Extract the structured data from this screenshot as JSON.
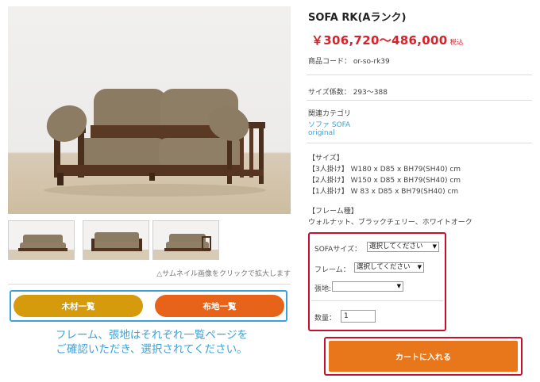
{
  "product": {
    "title": "SOFA RK(Aランク)",
    "price": "￥306,720～486,000",
    "tax_label": "税込",
    "code_label": "商品コード：",
    "code_value": "or-so-rk39",
    "size_label": "サイズ係数：",
    "size_value": "293～388"
  },
  "category": {
    "heading": "関連カテゴリ",
    "links": [
      "ソファ SOFA",
      "original"
    ]
  },
  "specs": {
    "size_heading": "【サイズ】",
    "size_lines": [
      "【3人掛け】 W180 x D85 x BH79(SH40) cm",
      "【2人掛け】 W150 x D85 x BH79(SH40) cm",
      "【1人掛け】 W 83 x D85 x BH79(SH40) cm"
    ],
    "frame_heading": "【フレーム種】",
    "frame_values": "ウォルナット、ブラックチェリー、ホワイトオーク"
  },
  "options": {
    "sofa_size_label": "SOFAサイズ：",
    "sofa_size_value": "選択してください",
    "frame_label": "フレーム：",
    "frame_value": "選択してください",
    "fabric_label": "張地:",
    "fabric_value": "",
    "qty_label": "数量：",
    "qty_value": "1"
  },
  "gallery": {
    "thumb_note": "△サムネイル画像をクリックで拡大します"
  },
  "buttons": {
    "wood_list": "木材一覧",
    "fabric_list": "布地一覧",
    "add_to_cart": "カートに入れる"
  },
  "annotation": {
    "line1": "フレーム、張地はそれぞれ一覧ページを",
    "line2": "ご確認いただき、選択されてください。"
  },
  "colors": {
    "price_red": "#d82128",
    "highlight_red": "#c8102e",
    "highlight_blue": "#3ba2d9",
    "wood_button": "#d69b0c",
    "fabric_button": "#e8631a",
    "cart_button": "#e8761a"
  }
}
